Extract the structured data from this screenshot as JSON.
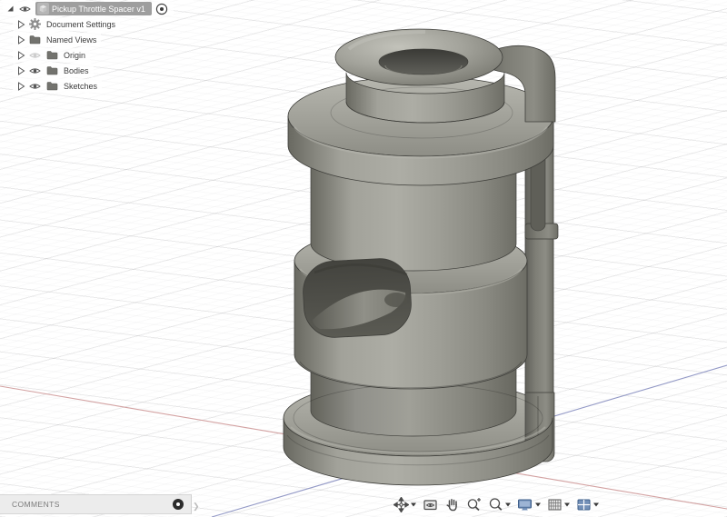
{
  "browser": {
    "root": {
      "label": "Pickup Throttle Spacer v1"
    },
    "items": [
      {
        "label": "Document Settings",
        "icon": "gear-icon",
        "eye": "none"
      },
      {
        "label": "Named Views",
        "icon": "folder-icon",
        "eye": "none"
      },
      {
        "label": "Origin",
        "icon": "folder-icon",
        "eye": "hidden"
      },
      {
        "label": "Bodies",
        "icon": "folder-icon",
        "eye": "visible"
      },
      {
        "label": "Sketches",
        "icon": "folder-icon",
        "eye": "visible"
      }
    ]
  },
  "comments": {
    "label": "COMMENTS"
  },
  "nav_toolbar": {
    "items": [
      {
        "name": "Orbit",
        "icon": "orbit-icon",
        "has_caret": true
      },
      {
        "name": "Look At",
        "icon": "look-at-icon",
        "has_caret": false
      },
      {
        "name": "Pan",
        "icon": "pan-icon",
        "has_caret": false
      },
      {
        "name": "Zoom",
        "icon": "zoom-icon",
        "has_caret": false
      },
      {
        "name": "Fit",
        "icon": "fit-icon",
        "has_caret": true
      },
      {
        "name": "Display Settings",
        "icon": "display-settings-icon",
        "has_caret": true
      },
      {
        "name": "Layout Grid",
        "icon": "layout-grid-icon",
        "has_caret": true
      },
      {
        "name": "Viewports",
        "icon": "viewports-icon",
        "has_caret": true
      }
    ]
  },
  "colors": {
    "model_body": "#9a9a92",
    "model_highlight": "#b6b6ae",
    "model_shadow": "#68615c",
    "axis_red": "#d3a2a2",
    "axis_blue": "#9399c6",
    "selection_bg": "#9e9e9e",
    "canvas_bg": "#ffffff"
  }
}
